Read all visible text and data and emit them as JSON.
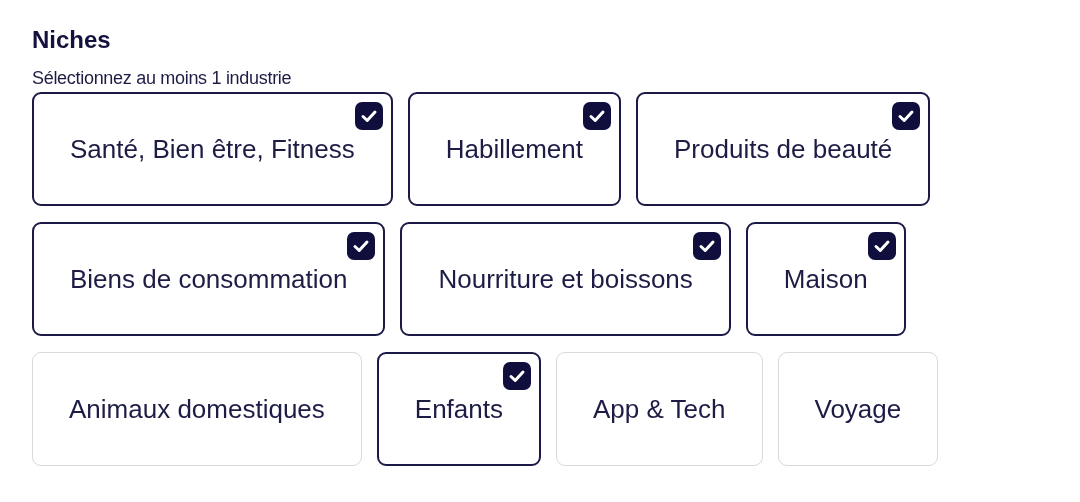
{
  "title": "Niches",
  "subtitle": "Sélectionnez au moins 1 industrie",
  "rows": [
    [
      {
        "label": "Santé, Bien être, Fitness",
        "checked": true
      },
      {
        "label": "Habillement",
        "checked": true
      },
      {
        "label": "Produits de beauté",
        "checked": true
      }
    ],
    [
      {
        "label": "Biens de consommation",
        "checked": true
      },
      {
        "label": "Nourriture et boissons",
        "checked": true
      },
      {
        "label": "Maison",
        "checked": true
      }
    ],
    [
      {
        "label": "Animaux domestiques",
        "checked": false
      },
      {
        "label": "Enfants",
        "checked": true
      },
      {
        "label": "App & Tech",
        "checked": false
      },
      {
        "label": "Voyage",
        "checked": false
      }
    ]
  ]
}
